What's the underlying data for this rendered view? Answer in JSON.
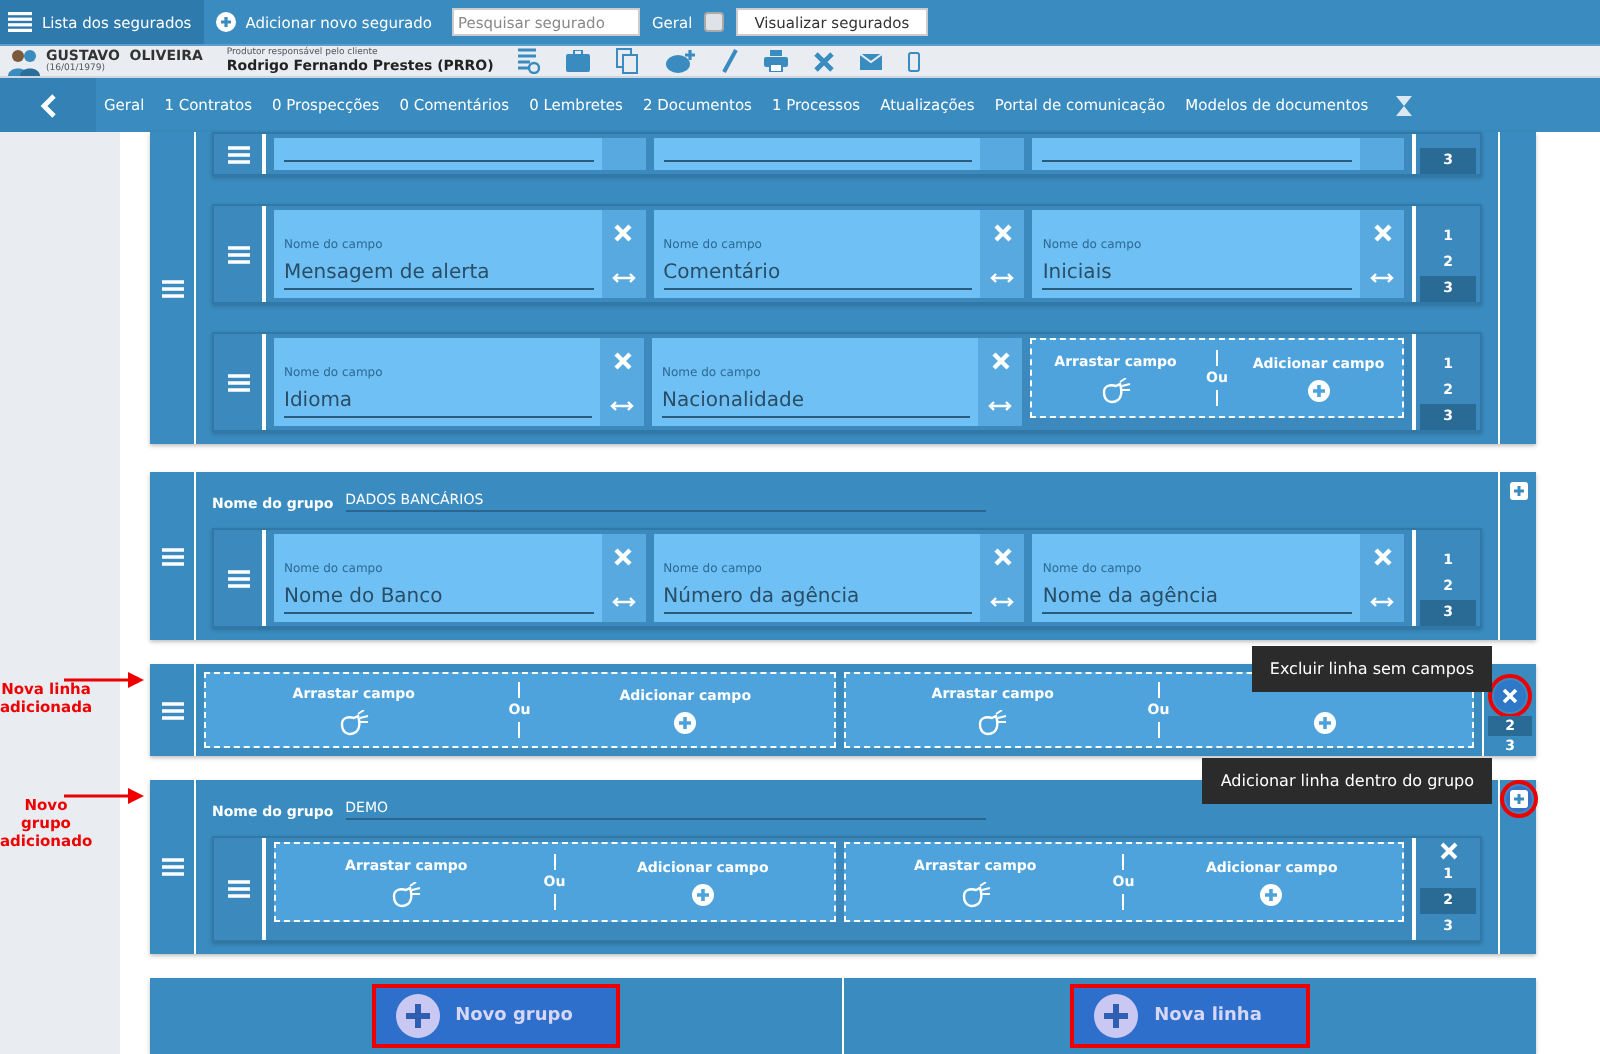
{
  "top_bar": {
    "list_link": "Lista dos segurados",
    "add_link": "Adicionar novo segurado",
    "search": {
      "placeholder": "Pesquisar segurado"
    },
    "general": {
      "label": "Geral",
      "checked": false
    },
    "view_button": "Visualizar segurados"
  },
  "client": {
    "name": "GUSTAVO  OLIVEIRA",
    "birth": "(16/01/1979)",
    "producer_caption": "Produtor responsável pelo cliente",
    "producer": "Rodrigo Fernando Prestes (PRRO)"
  },
  "tabs": [
    {
      "label": "Geral"
    },
    {
      "label": "1 Contratos"
    },
    {
      "label": "0 Prospecções"
    },
    {
      "label": "0 Comentários"
    },
    {
      "label": "0 Lembretes"
    },
    {
      "label": "2 Documentos"
    },
    {
      "label": "1 Processos"
    },
    {
      "label": "Atualizações"
    },
    {
      "label": "Portal de comunicação"
    },
    {
      "label": "Modelos de documentos"
    }
  ],
  "blocks": [
    {
      "kind": "group",
      "rows": [
        {
          "columns": [
            {
              "label": "3",
              "selected": true
            }
          ],
          "slots": [
            {
              "kind": "blank"
            },
            {
              "kind": "blank"
            },
            {
              "kind": "blank"
            }
          ]
        },
        {
          "columns": [
            {
              "label": "1",
              "selected": false
            },
            {
              "label": "2",
              "selected": false
            },
            {
              "label": "3",
              "selected": true
            }
          ],
          "slots": [
            {
              "kind": "field",
              "label": "Nome do campo",
              "value": "Mensagem de alerta"
            },
            {
              "kind": "field",
              "label": "Nome do campo",
              "value": "Comentário"
            },
            {
              "kind": "field",
              "label": "Nome do campo",
              "value": "Iniciais"
            }
          ]
        },
        {
          "columns": [
            {
              "label": "1",
              "selected": false
            },
            {
              "label": "2",
              "selected": false
            },
            {
              "label": "3",
              "selected": true
            }
          ],
          "slots": [
            {
              "kind": "field",
              "label": "Nome do campo",
              "value": "Idioma"
            },
            {
              "kind": "field",
              "label": "Nome do campo",
              "value": "Nacionalidade"
            },
            {
              "kind": "drop",
              "drag": "Arrastar campo",
              "or": "Ou",
              "add": "Adicionar campo"
            }
          ]
        }
      ]
    },
    {
      "kind": "group",
      "group_name": {
        "label": "Nome do grupo",
        "value": "DADOS BANCÁRIOS"
      },
      "add_row_button": {
        "highlighted": false
      },
      "rows": [
        {
          "columns": [
            {
              "label": "1",
              "selected": false
            },
            {
              "label": "2",
              "selected": false
            },
            {
              "label": "3",
              "selected": true
            }
          ],
          "slots": [
            {
              "kind": "field",
              "label": "Nome do campo",
              "value": "Nome do Banco"
            },
            {
              "kind": "field",
              "label": "Nome do campo",
              "value": "Número da agência"
            },
            {
              "kind": "field",
              "label": "Nome do campo",
              "value": "Nome da agência"
            }
          ]
        }
      ]
    },
    {
      "kind": "line",
      "annotation": "Nova linha adicionada",
      "tooltip": "Excluir linha sem campos",
      "delete_button": {
        "highlighted": true
      },
      "columns": [
        {
          "label": "2",
          "selected": true
        },
        {
          "label": "3",
          "selected": false
        }
      ],
      "slots": [
        {
          "kind": "drop",
          "drag": "Arrastar campo",
          "or": "Ou",
          "add": "Adicionar campo"
        },
        {
          "kind": "drop",
          "drag": "Arrastar campo",
          "or": "Ou"
        }
      ]
    },
    {
      "kind": "group",
      "annotation": "Novo grupo adicionado",
      "tooltip": "Adicionar linha dentro do grupo",
      "group_name": {
        "label": "Nome do grupo",
        "value": "DEMO"
      },
      "add_row_button": {
        "highlighted": true
      },
      "rows": [
        {
          "delete_button": {
            "highlighted": false
          },
          "columns": [
            {
              "label": "1",
              "selected": false
            },
            {
              "label": "2",
              "selected": true
            },
            {
              "label": "3",
              "selected": false
            }
          ],
          "slots": [
            {
              "kind": "drop",
              "drag": "Arrastar campo",
              "or": "Ou",
              "add": "Adicionar campo"
            },
            {
              "kind": "drop",
              "drag": "Arrastar campo",
              "or": "Ou",
              "add": "Adicionar campo"
            }
          ]
        }
      ]
    }
  ],
  "actions": [
    {
      "label": "Novo grupo",
      "highlighted": true
    },
    {
      "label": "Nova linha",
      "highlighted": true
    }
  ]
}
